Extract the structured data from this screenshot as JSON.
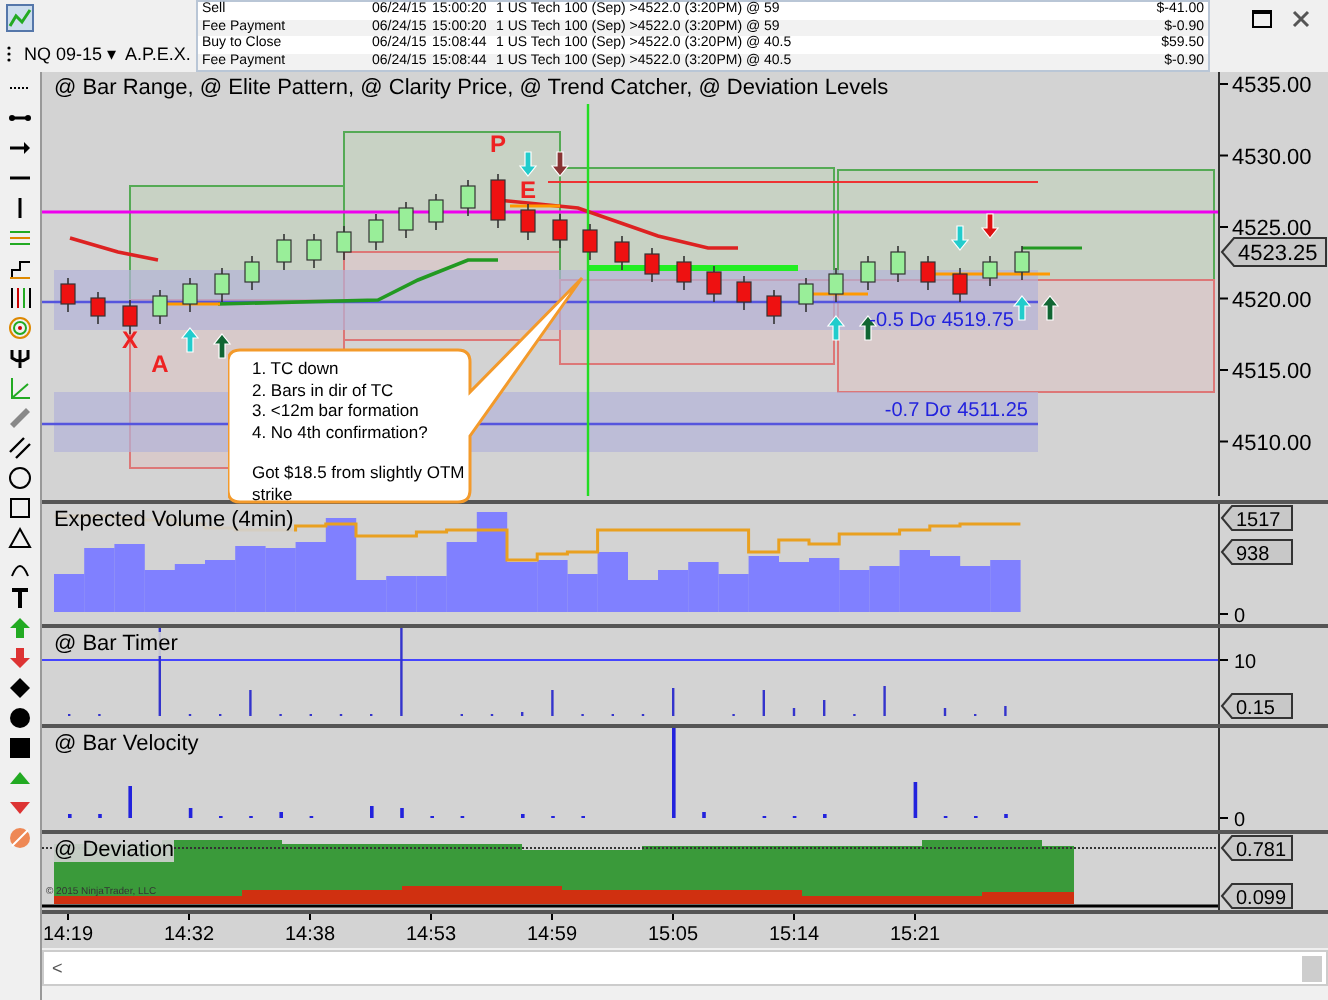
{
  "toolbar": {
    "instrument": "NQ 09-15",
    "caret": "▾",
    "template": "A.P.E.X."
  },
  "trades": [
    {
      "action": "Sell",
      "date": "06/24/15",
      "time": "15:00:20",
      "description": "1 US Tech 100 (Sep) >4522.0 (3:20PM) @ 59",
      "amount": "$-41.00"
    },
    {
      "action": "Fee Payment",
      "date": "06/24/15",
      "time": "15:00:20",
      "description": "1 US Tech 100 (Sep) >4522.0 (3:20PM) @ 59",
      "amount": "$-0.90"
    },
    {
      "action": "Buy to Close",
      "date": "06/24/15",
      "time": "15:08:44",
      "description": "1 US Tech 100 (Sep) >4522.0 (3:20PM) @ 40.5",
      "amount": "$59.50"
    },
    {
      "action": "Fee Payment",
      "date": "06/24/15",
      "time": "15:08:44",
      "description": "1 US Tech 100 (Sep) >4522.0 (3:20PM) @ 40.5",
      "amount": "$-0.90"
    }
  ],
  "price_panel": {
    "title": "@ Bar Range, @ Elite Pattern, @ Clarity Price, @ Trend Catcher, @ Deviation Levels",
    "axis_labels": [
      "4535.00",
      "4530.00",
      "4525.00",
      "4520.00",
      "4515.00",
      "4510.00"
    ],
    "last_price": "4523.25",
    "markers": [
      "P",
      "E",
      "X",
      "A"
    ],
    "levels": [
      "-0.5 Dσ 4519.75",
      "-0.7 Dσ 4511.25"
    ],
    "note": {
      "lines": [
        "1. TC down",
        "2. Bars in dir of TC",
        "3. <12m bar formation",
        "4. No 4th confirmation?"
      ],
      "remark": "Got $18.5 from slightly OTM strike"
    }
  },
  "panels": [
    {
      "kind": "volume",
      "title": "Expected Volume (4min)",
      "tags": [
        "1517",
        "938"
      ],
      "ticks": [
        "0"
      ]
    },
    {
      "kind": "timer",
      "title": "@ Bar Timer",
      "tags": [
        "0.15"
      ],
      "ticks": [
        "10"
      ]
    },
    {
      "kind": "velocity",
      "title": "@ Bar Velocity",
      "ticks": [
        "0"
      ]
    },
    {
      "kind": "deviation",
      "title": "@ Deviation",
      "tags": [
        "0.781",
        "0.099"
      ],
      "copyright": "© 2015 NinjaTrader, LLC"
    }
  ],
  "time_axis": [
    "14:19",
    "14:32",
    "14:38",
    "14:53",
    "14:59",
    "15:05",
    "15:14",
    "15:21"
  ],
  "scrollbar": {
    "left_arrow": "<"
  }
}
